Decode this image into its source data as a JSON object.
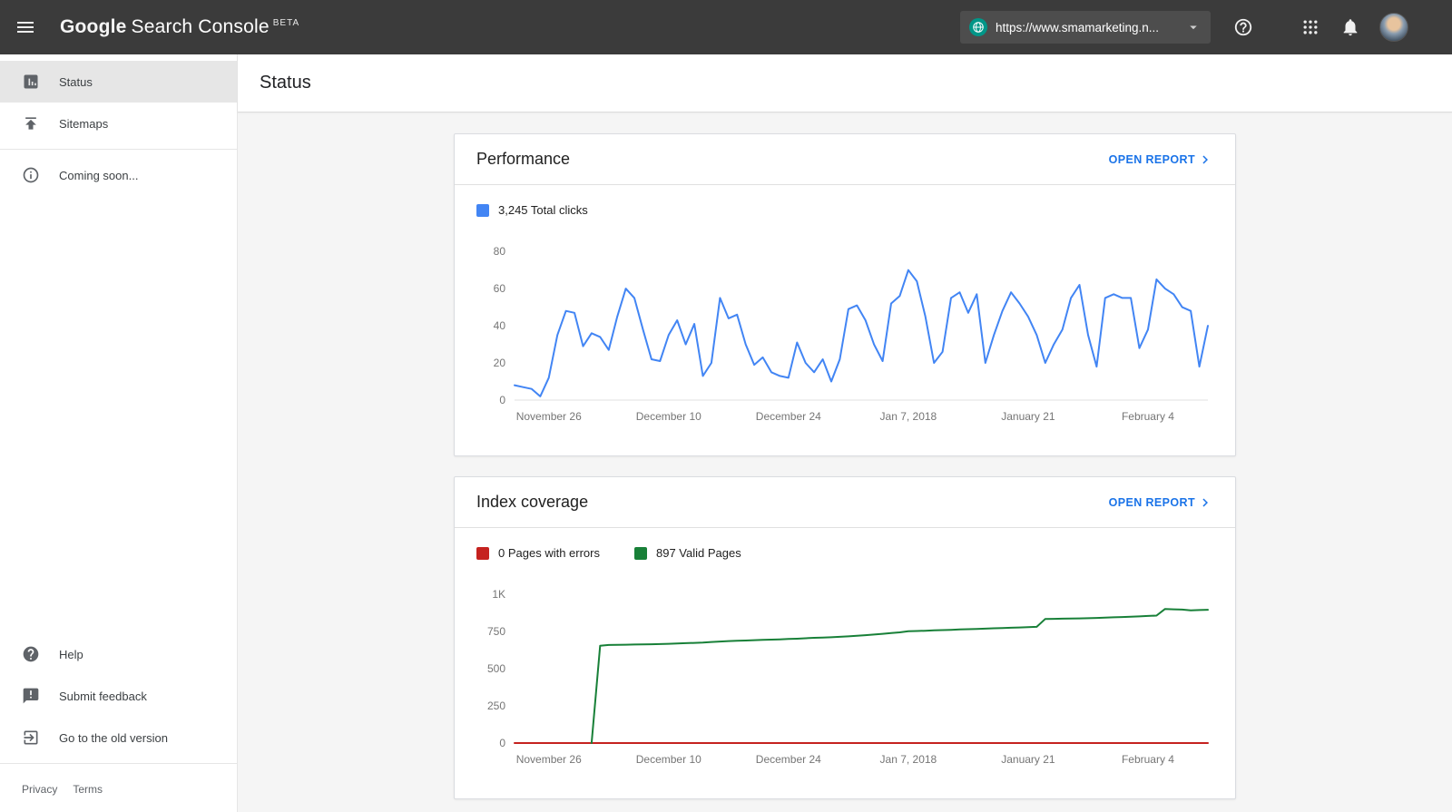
{
  "topbar": {
    "brand": "Google",
    "product": "Search Console",
    "beta_label": "BETA",
    "property_url": "https://www.smamarketing.n..."
  },
  "sidebar": {
    "items": [
      {
        "label": "Status",
        "icon": "bar-chart-icon",
        "selected": true
      },
      {
        "label": "Sitemaps",
        "icon": "upload-icon",
        "selected": false
      },
      {
        "label": "Coming soon...",
        "icon": "info-icon",
        "selected": false
      }
    ],
    "footer_items": [
      {
        "label": "Help",
        "icon": "help-icon"
      },
      {
        "label": "Submit feedback",
        "icon": "feedback-icon"
      },
      {
        "label": "Go to the old version",
        "icon": "exit-icon"
      }
    ],
    "legal": {
      "privacy": "Privacy",
      "terms": "Terms"
    }
  },
  "header": {
    "page_title": "Status"
  },
  "cards": {
    "performance": {
      "title": "Performance",
      "open_report": "OPEN REPORT",
      "legend_label": "3,245 Total clicks"
    },
    "index_coverage": {
      "title": "Index coverage",
      "open_report": "OPEN REPORT",
      "legend_errors": "0 Pages with errors",
      "legend_valid": "897 Valid Pages"
    }
  },
  "colors": {
    "accent_blue": "#1a73e8",
    "line_blue": "#4285f4",
    "valid_green": "#188038",
    "error_red": "#c5221f",
    "teal": "#009688"
  },
  "chart_data": [
    {
      "type": "line",
      "title": "Performance - Total clicks",
      "n_points": 82,
      "ylim": [
        0,
        84
      ],
      "ytick_values": [
        0,
        20,
        40,
        60,
        80
      ],
      "ytick_labels": [
        "0",
        "20",
        "40",
        "60",
        "80"
      ],
      "x_tick_indices": [
        4,
        18,
        32,
        46,
        60,
        74
      ],
      "x_tick_labels": [
        "November 26",
        "December 10",
        "December 24",
        "Jan 7, 2018",
        "January 21",
        "February 4"
      ],
      "series": [
        {
          "name": "Total clicks",
          "color": "#4285f4",
          "values": [
            8,
            7,
            6,
            2,
            12,
            35,
            48,
            47,
            29,
            36,
            34,
            27,
            45,
            60,
            55,
            38,
            22,
            21,
            35,
            43,
            30,
            41,
            13,
            20,
            55,
            44,
            46,
            30,
            19,
            23,
            15,
            13,
            12,
            31,
            20,
            15,
            22,
            10,
            22,
            49,
            51,
            43,
            30,
            21,
            52,
            56,
            70,
            64,
            45,
            20,
            26,
            55,
            58,
            47,
            57,
            20,
            35,
            48,
            58,
            52,
            45,
            35,
            20,
            30,
            38,
            55,
            62,
            35,
            18,
            55,
            57,
            55,
            55,
            28,
            38,
            65,
            60,
            57,
            50,
            48,
            18,
            40
          ]
        }
      ]
    },
    {
      "type": "line",
      "title": "Index coverage",
      "n_points": 82,
      "ylim": [
        0,
        1050
      ],
      "ytick_values": [
        0,
        250,
        500,
        750,
        1000
      ],
      "ytick_labels": [
        "0",
        "250",
        "500",
        "750",
        "1K"
      ],
      "x_tick_indices": [
        4,
        18,
        32,
        46,
        60,
        74
      ],
      "x_tick_labels": [
        "November 26",
        "December 10",
        "December 24",
        "Jan 7, 2018",
        "January 21",
        "February 4"
      ],
      "series": [
        {
          "name": "Pages with errors",
          "color": "#c5221f",
          "constant": 0
        },
        {
          "name": "Valid Pages",
          "color": "#188038",
          "values": [
            null,
            null,
            null,
            null,
            null,
            null,
            null,
            null,
            null,
            0,
            655,
            660,
            661,
            662,
            663,
            664,
            665,
            666,
            668,
            670,
            672,
            674,
            676,
            680,
            683,
            686,
            688,
            690,
            692,
            694,
            696,
            698,
            700,
            702,
            705,
            708,
            710,
            712,
            715,
            718,
            722,
            726,
            730,
            735,
            740,
            745,
            752,
            754,
            756,
            758,
            760,
            762,
            764,
            766,
            768,
            770,
            772,
            774,
            776,
            778,
            780,
            782,
            835,
            836,
            837,
            838,
            839,
            840,
            842,
            844,
            846,
            848,
            850,
            852,
            855,
            858,
            902,
            900,
            898,
            893,
            895,
            897
          ]
        }
      ]
    }
  ]
}
